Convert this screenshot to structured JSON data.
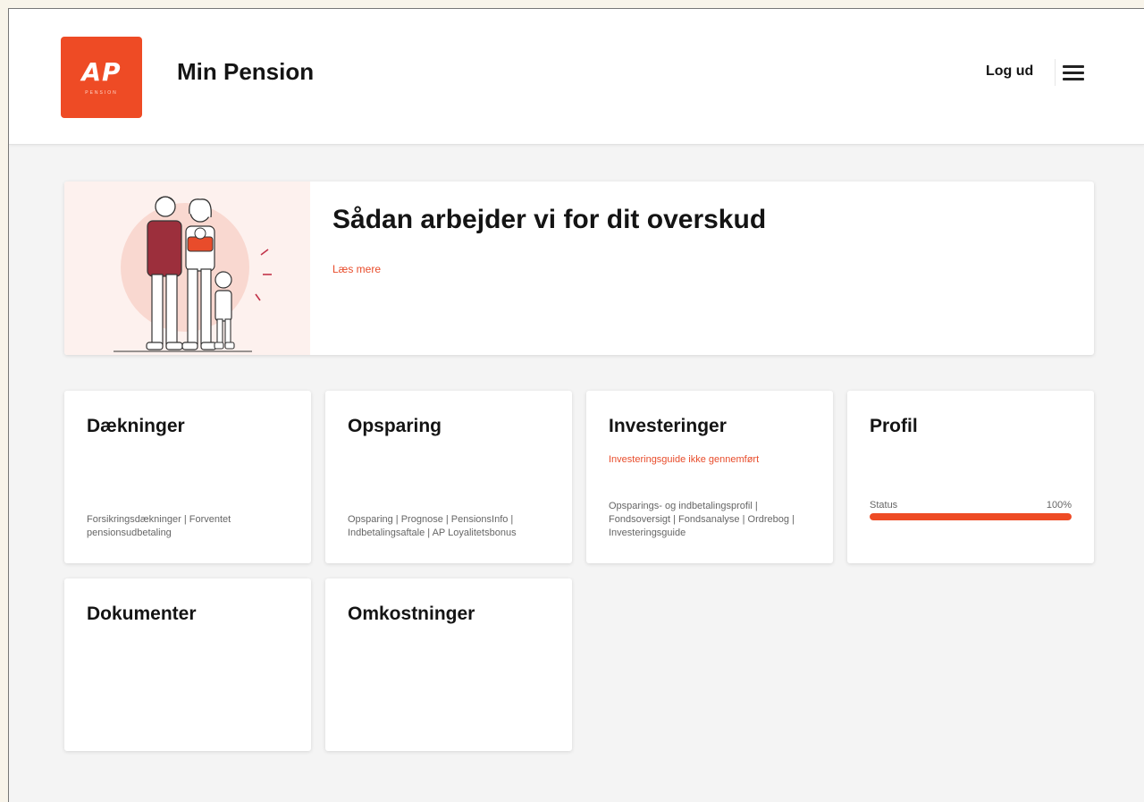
{
  "colors": {
    "brand": "#ee4b25",
    "accent": "#e84c2b",
    "progress": "#ee4b25"
  },
  "header": {
    "logo_text": "AP",
    "logo_subtext": "PENSION",
    "title": "Min Pension",
    "logout_label": "Log ud",
    "menu_icon": "hamburger-icon"
  },
  "banner": {
    "title": "Sådan arbejder vi for dit overskud",
    "link_label": "Læs mere",
    "illustration": "family-illustration"
  },
  "cards": {
    "daekninger": {
      "title": "Dækninger",
      "description": "Forsikringsdækninger | Forventet pensionsudbetaling"
    },
    "opsparing": {
      "title": "Opsparing",
      "description": "Opsparing | Prognose | PensionsInfo | Indbetalingsaftale | AP Loyalitetsbonus"
    },
    "investeringer": {
      "title": "Investeringer",
      "alert": "Investeringsguide ikke gennemført",
      "description": "Opsparings- og indbetalingsprofil | Fondsoversigt | Fondsanalyse | Ordrebog | Investeringsguide"
    },
    "profil": {
      "title": "Profil",
      "status_label": "Status",
      "status_value": "100%",
      "status_progress": 1.0
    },
    "dokumenter": {
      "title": "Dokumenter"
    },
    "omkostninger": {
      "title": "Omkostninger"
    }
  }
}
